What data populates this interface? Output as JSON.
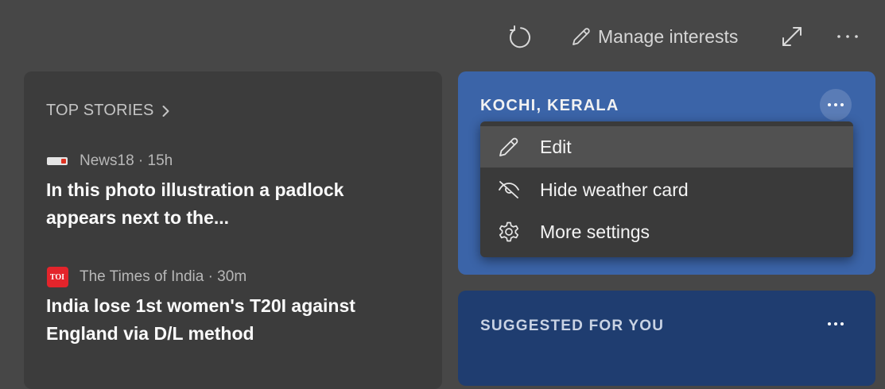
{
  "toolbar": {
    "refresh_icon": "refresh-icon",
    "manage_label": "Manage interests",
    "manage_icon": "pencil-icon",
    "expand_icon": "expand-icon",
    "more_icon": "more-horizontal-icon"
  },
  "top_stories": {
    "header": "TOP STORIES",
    "stories": [
      {
        "source": "News18 · 15h",
        "source_logo": "news18-logo",
        "headline": "In this photo illustration a padlock appears next to the..."
      },
      {
        "source": "The Times of India · 30m",
        "source_logo": "toi-logo",
        "logo_text": "TOI",
        "headline": "India lose 1st women's T20I against England via D/L method"
      }
    ]
  },
  "weather": {
    "location": "KOCHI, KERALA",
    "color": "#3b64a8"
  },
  "context_menu": {
    "items": [
      {
        "label": "Edit",
        "icon": "pencil-icon"
      },
      {
        "label": "Hide weather card",
        "icon": "eye-off-icon"
      },
      {
        "label": "More settings",
        "icon": "gear-icon"
      }
    ]
  },
  "suggested": {
    "title": "SUGGESTED FOR YOU",
    "color": "#1f3d70"
  }
}
